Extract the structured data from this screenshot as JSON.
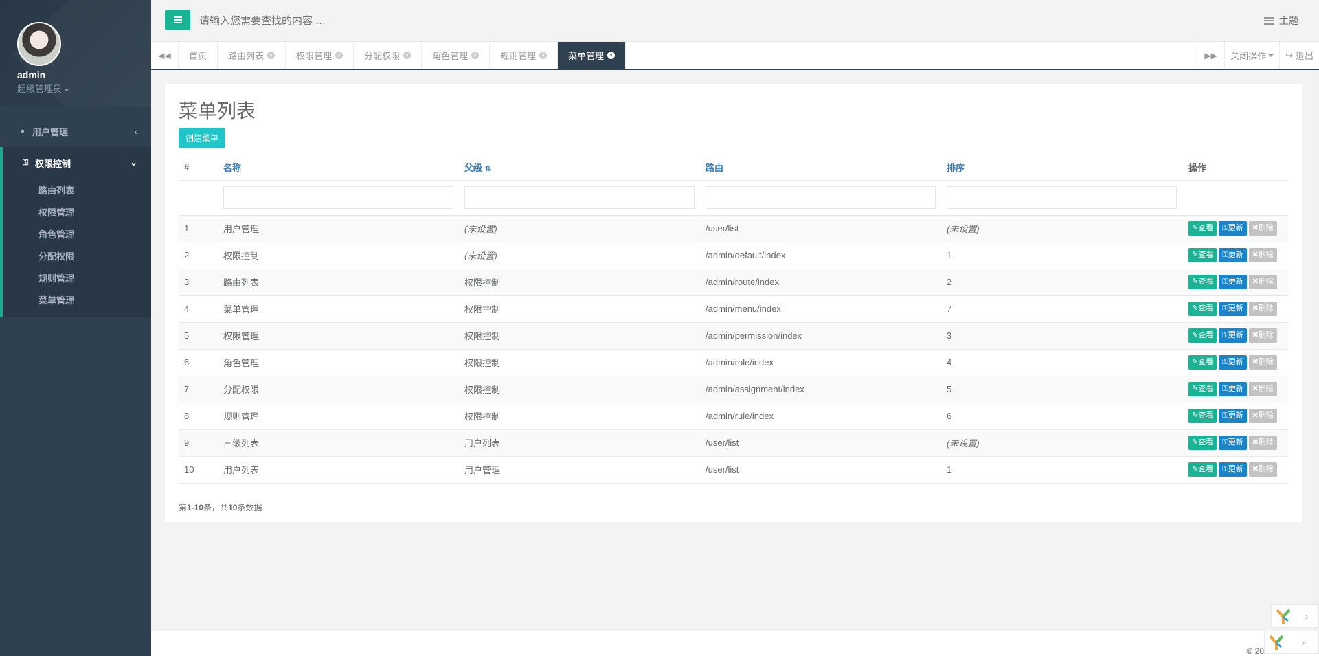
{
  "profile": {
    "name": "admin",
    "role": "超级管理员"
  },
  "sidebar": {
    "user_mgmt": "用户管理",
    "perm_ctrl": "权限控制",
    "sub_items": [
      "路由列表",
      "权限管理",
      "角色管理",
      "分配权限",
      "规则管理",
      "菜单管理"
    ]
  },
  "header": {
    "search_placeholder": "请输入您需要查找的内容 …",
    "theme_label": "主题"
  },
  "tabs": [
    {
      "label": "首页"
    },
    {
      "label": "路由列表"
    },
    {
      "label": "权限管理"
    },
    {
      "label": "分配权限"
    },
    {
      "label": "角色管理"
    },
    {
      "label": "规则管理"
    },
    {
      "label": "菜单管理"
    }
  ],
  "tab_right": {
    "close_ops": "关闭操作",
    "logout": "退出"
  },
  "page": {
    "title": "菜单列表",
    "create_label": "创建菜单"
  },
  "table": {
    "headers": {
      "num": "#",
      "name": "名称",
      "parent": "父级",
      "route": "路由",
      "order": "排序",
      "ops": "操作"
    },
    "rows": [
      {
        "num": "1",
        "name": "用户管理",
        "parent": "(未设置)",
        "route": "/user/list",
        "order": "(未设置)"
      },
      {
        "num": "2",
        "name": "权限控制",
        "parent": "(未设置)",
        "route": "/admin/default/index",
        "order": "1"
      },
      {
        "num": "3",
        "name": "路由列表",
        "parent": "权限控制",
        "route": "/admin/route/index",
        "order": "2"
      },
      {
        "num": "4",
        "name": "菜单管理",
        "parent": "权限控制",
        "route": "/admin/menu/index",
        "order": "7"
      },
      {
        "num": "5",
        "name": "权限管理",
        "parent": "权限控制",
        "route": "/admin/permission/index",
        "order": "3"
      },
      {
        "num": "6",
        "name": "角色管理",
        "parent": "权限控制",
        "route": "/admin/role/index",
        "order": "4"
      },
      {
        "num": "7",
        "name": "分配权限",
        "parent": "权限控制",
        "route": "/admin/assignment/index",
        "order": "5"
      },
      {
        "num": "8",
        "name": "规则管理",
        "parent": "权限控制",
        "route": "/admin/rule/index",
        "order": "6"
      },
      {
        "num": "9",
        "name": "三级列表",
        "parent": "用户列表",
        "route": "/user/list",
        "order": "(未设置)"
      },
      {
        "num": "10",
        "name": "用户列表",
        "parent": "用户管理",
        "route": "/user/list",
        "order": "1"
      }
    ],
    "btn_view": "查看",
    "btn_update": "更新",
    "btn_delete": "删除"
  },
  "summary": {
    "prefix": "第",
    "range": "1-10",
    "mid": "条，共",
    "total": "10",
    "suffix": "条数据."
  },
  "footer": {
    "copyright": "© 20"
  },
  "colors": {
    "sidebar": "#2f4050",
    "accent": "#1ab394",
    "primary": "#1c84c6",
    "info": "#23c6c8"
  }
}
